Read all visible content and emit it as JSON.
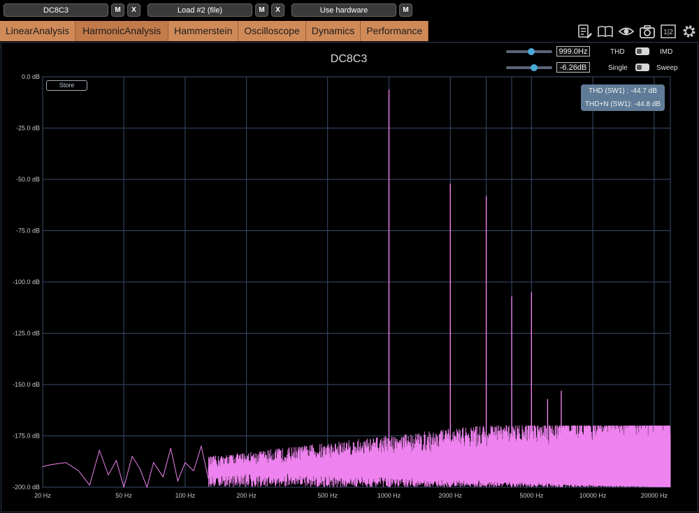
{
  "top": {
    "device1": "DC8C3",
    "m1": "M",
    "x1": "X",
    "device2": "Load #2 (file)",
    "m2": "M",
    "x2": "X",
    "device3": "Use hardware",
    "m3": "M"
  },
  "tabs": [
    "LinearAnalysis",
    "HarmonicAnalysis",
    "Hammerstein",
    "Oscilloscope",
    "Dynamics",
    "Performance"
  ],
  "toolbar_icons": [
    "notes-icon",
    "book-icon",
    "eye-icon",
    "camera-icon",
    "split-12-icon",
    "gear-icon"
  ],
  "split_icon_text": "1|2",
  "controls": {
    "freq_value": "999.0Hz",
    "freq_fraction": 0.55,
    "level_value": "-6.26dB",
    "level_fraction": 0.6,
    "thd_label": "THD",
    "imd_label": "IMD",
    "single_label": "Single",
    "sweep_label": "Sweep"
  },
  "store_label": "Store",
  "info": {
    "thd": "THD (SW1) : -44.7 dB",
    "thdn": "THD+N (SW1): -44.8 dB"
  },
  "colors": {
    "trace": "#ee82ee",
    "grid": "#3b4d6b",
    "tab": "#d08a58",
    "info_bg": "#5f7b97"
  },
  "chart_data": {
    "type": "line",
    "title": "DC8C3",
    "xscale": "log",
    "xlim": [
      20,
      24000
    ],
    "ylim": [
      -200,
      0
    ],
    "y_ticks": [
      "0.0 dB",
      "-25.0 dB",
      "-50.0 dB",
      "-75.0 dB",
      "-100.0 dB",
      "-125.0 dB",
      "-150.0 dB",
      "-175.0 dB",
      "-200.0 dB"
    ],
    "y_tick_values": [
      0,
      -25,
      -50,
      -75,
      -100,
      -125,
      -150,
      -175,
      -200
    ],
    "x_ticks": [
      "20 Hz",
      "50 Hz",
      "100 Hz",
      "200 Hz",
      "500 Hz",
      "1000 Hz",
      "2000 Hz",
      "5000 Hz",
      "10000 Hz",
      "20000 Hz"
    ],
    "x_tick_values": [
      20,
      50,
      100,
      200,
      500,
      1000,
      2000,
      5000,
      10000,
      20000
    ],
    "x_grid_values": [
      20,
      50,
      100,
      200,
      500,
      1000,
      2000,
      3000,
      4000,
      5000,
      10000,
      20000
    ],
    "harmonics": [
      {
        "freq": 1000,
        "db": -6.3
      },
      {
        "freq": 2000,
        "db": -52
      },
      {
        "freq": 3000,
        "db": -58
      },
      {
        "freq": 4000,
        "db": -107
      },
      {
        "freq": 5000,
        "db": -105
      },
      {
        "freq": 6000,
        "db": -157
      },
      {
        "freq": 7000,
        "db": -153
      }
    ],
    "noise_floor_low": [
      [
        20,
        -190
      ],
      [
        22,
        -189
      ],
      [
        26,
        -188
      ],
      [
        30,
        -192
      ],
      [
        34,
        -199
      ],
      [
        38,
        -182
      ],
      [
        42,
        -194
      ],
      [
        46,
        -187
      ],
      [
        50,
        -200
      ],
      [
        55,
        -185
      ],
      [
        60,
        -191
      ],
      [
        65,
        -200
      ],
      [
        70,
        -188
      ],
      [
        78,
        -195
      ],
      [
        85,
        -181
      ],
      [
        92,
        -197
      ],
      [
        100,
        -188
      ],
      [
        110,
        -192
      ],
      [
        120,
        -180
      ],
      [
        130,
        -196
      ]
    ],
    "grid": true
  }
}
